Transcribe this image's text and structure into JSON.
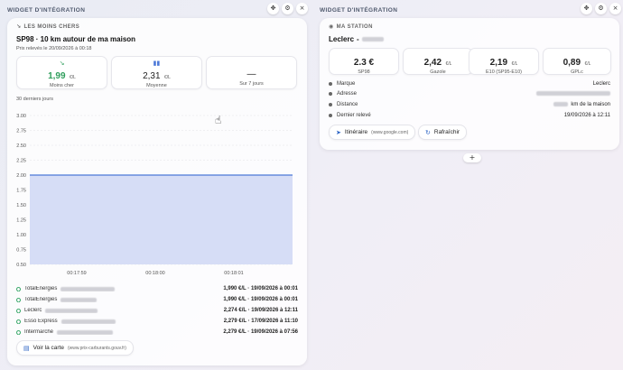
{
  "left_widget": {
    "header": "WIDGET D'INTÉGRATION",
    "section_label": "LES MOINS CHERS",
    "title": "SP98 · 10 km autour de ma maison",
    "subtitle": "Prix relevés le 20/09/2026 à 00:18",
    "stats": [
      {
        "value": "1,99",
        "unit": "€/L",
        "label": "Moins cher",
        "color": "#2e9d5b"
      },
      {
        "value": "2,31",
        "unit": "€/L",
        "label": "Moyenne",
        "color": "#222222"
      },
      {
        "value": "—",
        "unit": "",
        "label": "Sur 7 jours",
        "color": "#222222"
      }
    ],
    "chart_caption": "30 derniers jours",
    "stations": [
      {
        "name": "TotalEnergies",
        "info": "1,990 €/L · 19/09/2026 à 00:01"
      },
      {
        "name": "TotalEnergies",
        "info": "1,990 €/L · 19/09/2026 à 00:01"
      },
      {
        "name": "Leclerc",
        "info": "2,274 €/L · 19/09/2026 à 12:11"
      },
      {
        "name": "Esso Express",
        "info": "2,279 €/L · 17/09/2026 à 11:10"
      },
      {
        "name": "Intermarché",
        "info": "2,279 €/L · 19/09/2026 à 07:56"
      }
    ],
    "map_button": "Voir la carte",
    "map_button_note": "(www.prix-carburants.gouv.fr)"
  },
  "right_widget": {
    "header": "WIDGET D'INTÉGRATION",
    "section_label": "MA STATION",
    "title": "Leclerc",
    "prices": [
      {
        "value": "2.3 €",
        "unit": "",
        "label": "SP98"
      },
      {
        "value": "2,42",
        "unit": "€/L",
        "label": "Gazole"
      },
      {
        "value": "2,19",
        "unit": "€/L",
        "label": "E10 (SP95-E10)"
      },
      {
        "value": "0,89",
        "unit": "€/L",
        "label": "GPLc"
      }
    ],
    "details": {
      "marque_key": "Marque",
      "marque_val": "Leclerc",
      "adresse_key": "Adresse",
      "distance_key": "Distance",
      "distance_val": "km de la maison",
      "releve_key": "Dernier relevé",
      "releve_val": "19/09/2026 à 12:11"
    },
    "itinerary_button": "Itinéraire",
    "itinerary_note": "(www.google.com)",
    "refresh_button": "Rafraîchir"
  },
  "add_symbol": "+",
  "chart_data": {
    "type": "area",
    "x": [
      "00:17:59",
      "00:18:00",
      "00:18:01"
    ],
    "series": [
      {
        "values": [
          2.0,
          2.0,
          2.0
        ]
      }
    ],
    "y_ticks": [
      "3.00",
      "2.75",
      "2.50",
      "2.25",
      "2.00",
      "1.75",
      "1.50",
      "1.25",
      "1.00",
      "0.75",
      "0.50"
    ],
    "ylim": [
      0.5,
      3.0
    ],
    "grid": true,
    "colors": {
      "line": "#4d79d8",
      "fill": "#d6ddf6"
    }
  }
}
